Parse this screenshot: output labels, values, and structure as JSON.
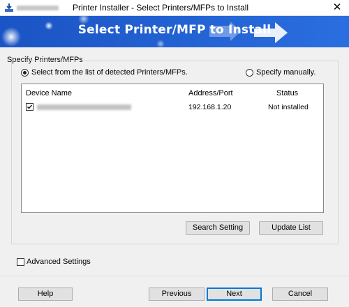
{
  "window": {
    "title": "Printer Installer - Select Printers/MFPs to Install",
    "close_glyph": "✕"
  },
  "banner": {
    "title": "Select Printer/MFP to Install"
  },
  "specify_group": {
    "label": "Specify Printers/MFPs",
    "option_detected": "Select from the list of detected Printers/MFPs.",
    "option_manual": "Specify manually.",
    "selected": "detected"
  },
  "device_list": {
    "columns": [
      "Device Name",
      "Address/Port",
      "Status"
    ],
    "rows": [
      {
        "checked": true,
        "address": "192.168.1.20",
        "status": "Not installed"
      }
    ]
  },
  "buttons": {
    "search_setting": "Search Setting",
    "update_list": "Update List",
    "help": "Help",
    "previous": "Previous",
    "next": "Next",
    "cancel": "Cancel"
  },
  "advanced": {
    "label": "Advanced Settings",
    "checked": false
  },
  "colors": {
    "banner": "#1f5fd1",
    "accent": "#0078d7"
  },
  "icons": [
    "printer-download-icon",
    "close-icon",
    "arrow-right-icon",
    "checkmark-icon"
  ]
}
